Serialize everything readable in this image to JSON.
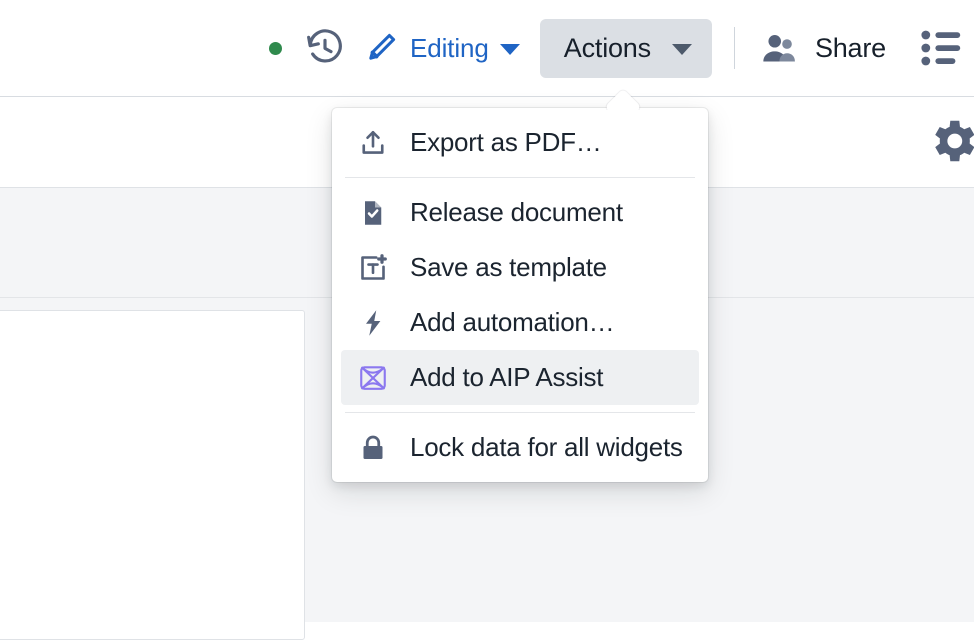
{
  "topbar": {
    "status_dot": {
      "name": "live-status-dot",
      "color": "#2f8a4d"
    },
    "history_icon": "history-icon",
    "edit_mode": {
      "icon": "pencil-icon",
      "label": "Editing",
      "caret": "chevron-down-icon",
      "color": "#1f64c4"
    },
    "actions_button": {
      "label": "Actions",
      "caret": "chevron-down-icon",
      "background": "#dbdfe4",
      "expanded": true
    },
    "share": {
      "icon": "people-icon",
      "label": "Share"
    },
    "list_icon": "bulleted-list-icon"
  },
  "subbar": {
    "gear_icon": "gear-icon"
  },
  "menu": {
    "groups": [
      {
        "items": [
          {
            "icon": "export-upload-icon",
            "label": "Export as PDF…",
            "selected": false
          }
        ]
      },
      {
        "items": [
          {
            "icon": "document-check-icon",
            "label": "Release document",
            "selected": false
          },
          {
            "icon": "template-text-add-icon",
            "label": "Save as template",
            "selected": false
          },
          {
            "icon": "lightning-bolt-icon",
            "label": "Add automation…",
            "selected": false
          },
          {
            "icon": "aip-assist-icon",
            "label": "Add to AIP Assist",
            "selected": true
          }
        ]
      },
      {
        "items": [
          {
            "icon": "lock-icon",
            "label": "Lock data for all widgets",
            "selected": false
          }
        ]
      }
    ]
  },
  "colors": {
    "icon_gray": "#56627a",
    "accent_blue": "#1f64c4",
    "aip_purple": "#8b78ef",
    "menu_highlight": "#eef0f2",
    "page_bg": "#f4f5f7"
  }
}
